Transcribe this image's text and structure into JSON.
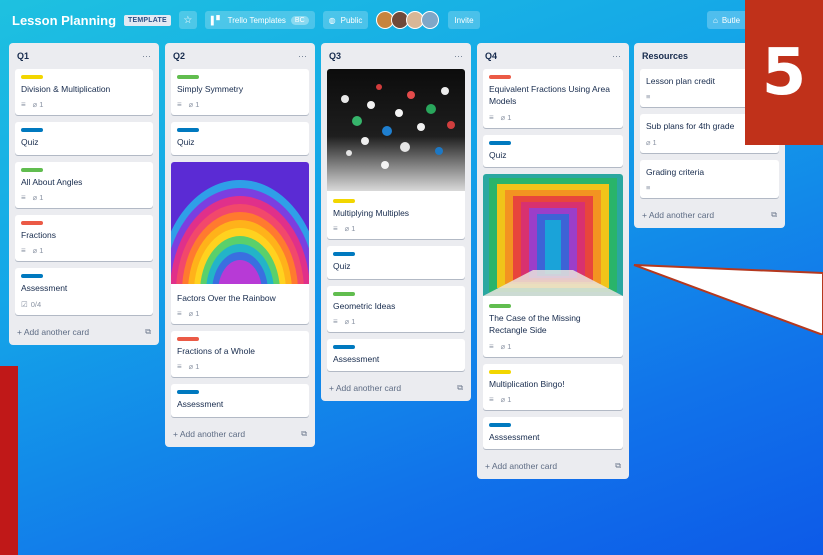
{
  "header": {
    "board_title": "Lesson Planning",
    "template_badge": "TEMPLATE",
    "team_label": "Trello Templates",
    "team_badge": "BC",
    "visibility_label": "Public",
    "invite_label": "Invite",
    "butler_label": "Butle"
  },
  "overlay": {
    "number": "5"
  },
  "lists": {
    "q1": {
      "title": "Q1",
      "cards": [
        {
          "title": "Division & Multiplication",
          "attachments": "1"
        },
        {
          "title": "Quiz"
        },
        {
          "title": "All About Angles",
          "attachments": "1"
        },
        {
          "title": "Fractions",
          "attachments": "1"
        },
        {
          "title": "Assessment",
          "checklist": "0/4"
        }
      ],
      "add_label": "+ Add another card"
    },
    "q2": {
      "title": "Q2",
      "cards": [
        {
          "title": "Simply Symmetry",
          "attachments": "1"
        },
        {
          "title": "Quiz"
        },
        {
          "title": "Factors Over the Rainbow",
          "attachments": "1"
        },
        {
          "title": "Fractions of a Whole",
          "attachments": "1"
        },
        {
          "title": "Assessment"
        }
      ],
      "add_label": "+ Add another card"
    },
    "q3": {
      "title": "Q3",
      "cards": [
        {
          "title": "Multiplying Multiples",
          "attachments": "1"
        },
        {
          "title": "Quiz"
        },
        {
          "title": "Geometric Ideas",
          "attachments": "1"
        },
        {
          "title": "Assessment"
        }
      ],
      "add_label": "+ Add another card"
    },
    "q4": {
      "title": "Q4",
      "cards": [
        {
          "title": "Equivalent Fractions Using Area Models",
          "attachments": "1"
        },
        {
          "title": "Quiz"
        },
        {
          "title": "The Case of the Missing Rectangle Side",
          "attachments": "1"
        },
        {
          "title": "Multiplication Bingo!",
          "attachments": "1"
        },
        {
          "title": "Asssessment"
        }
      ],
      "add_label": "+ Add another card"
    },
    "resources": {
      "title": "Resources",
      "cards": [
        {
          "title": "Lesson plan credit"
        },
        {
          "title": "Sub plans for 4th grade",
          "attachments": "1"
        },
        {
          "title": "Grading criteria"
        }
      ],
      "add_label": "+ Add another card"
    }
  },
  "colors": {
    "label_yellow": "#f2d600",
    "label_blue": "#0079bf",
    "label_green": "#61bd4f",
    "label_red": "#eb5a46",
    "overlay_red": "#c0311a"
  },
  "icons": {
    "attachment": "paperclip-icon",
    "description": "description-icon",
    "checklist": "checklist-icon"
  }
}
